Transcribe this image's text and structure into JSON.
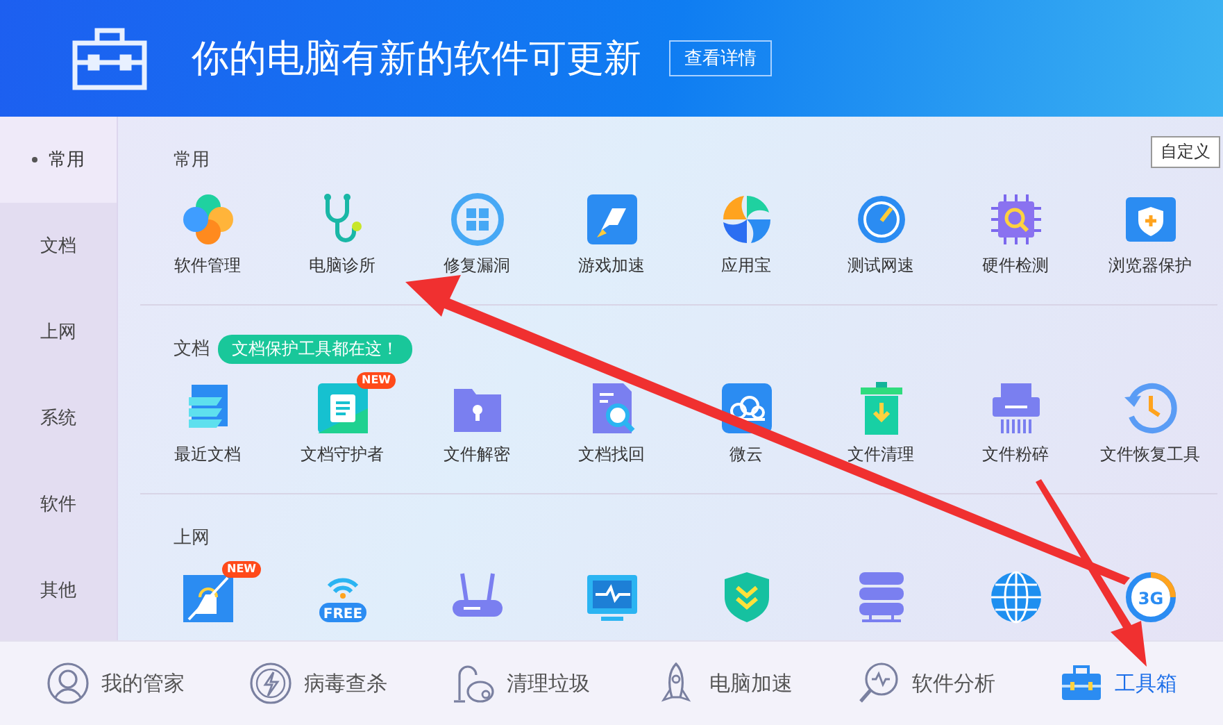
{
  "banner": {
    "title": "你的电脑有新的软件可更新",
    "button": "查看详情"
  },
  "sidebar": {
    "items": [
      {
        "label": "常用",
        "selected": true
      },
      {
        "label": "文档",
        "selected": false
      },
      {
        "label": "上网",
        "selected": false
      },
      {
        "label": "系统",
        "selected": false
      },
      {
        "label": "软件",
        "selected": false
      },
      {
        "label": "其他",
        "selected": false
      }
    ]
  },
  "customize_button": "自定义",
  "sections": [
    {
      "title": "常用",
      "items": [
        {
          "label": "软件管理"
        },
        {
          "label": "电脑诊所"
        },
        {
          "label": "修复漏洞"
        },
        {
          "label": "游戏加速"
        },
        {
          "label": "应用宝"
        },
        {
          "label": "测试网速"
        },
        {
          "label": "硬件检测"
        },
        {
          "label": "浏览器保护"
        }
      ]
    },
    {
      "title": "文档",
      "tip": "文档保护工具都在这！",
      "items": [
        {
          "label": "最近文档"
        },
        {
          "label": "文档守护者",
          "badge": "NEW"
        },
        {
          "label": "文件解密"
        },
        {
          "label": "文档找回"
        },
        {
          "label": "微云"
        },
        {
          "label": "文件清理"
        },
        {
          "label": "文件粉碎"
        },
        {
          "label": "文件恢复工具"
        }
      ]
    },
    {
      "title": "上网",
      "items": [
        {
          "kind": "tool",
          "badge": "NEW"
        },
        {
          "kind": "tool",
          "icon_text": "FREE"
        },
        {
          "kind": "tool"
        },
        {
          "kind": "tool"
        },
        {
          "kind": "tool"
        },
        {
          "kind": "tool"
        },
        {
          "kind": "tool"
        },
        {
          "kind": "tool",
          "icon_text": "3G"
        }
      ]
    }
  ],
  "bottom_nav": [
    {
      "label": "我的管家",
      "selected": false
    },
    {
      "label": "病毒查杀",
      "selected": false
    },
    {
      "label": "清理垃圾",
      "selected": false
    },
    {
      "label": "电脑加速",
      "selected": false
    },
    {
      "label": "软件分析",
      "selected": false
    },
    {
      "label": "工具箱",
      "selected": true
    }
  ],
  "overlay": {
    "red_arrows": true
  }
}
